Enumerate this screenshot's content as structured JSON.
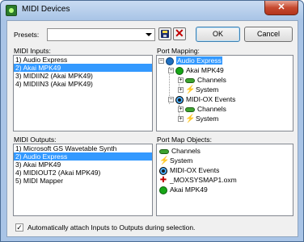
{
  "window": {
    "title": "MIDI Devices",
    "close_label": "✕"
  },
  "presets": {
    "label": "Presets:",
    "value": ""
  },
  "buttons": {
    "ok": "OK",
    "cancel": "Cancel"
  },
  "midi_inputs": {
    "label": "MIDI Inputs:",
    "items": [
      "1) Audio Express",
      "2) Akai MPK49",
      "3) MIDIIN2 (Akai MPK49)",
      "4) MIDIIN3 (Akai MPK49)"
    ],
    "selected_index": 1
  },
  "port_mapping": {
    "label": "Port Mapping:",
    "root": "Audio Express",
    "device1": "Akai MPK49",
    "device1_children": [
      "Channels",
      "System"
    ],
    "device2": "MIDI-OX Events",
    "device2_children": [
      "Channels",
      "System"
    ]
  },
  "midi_outputs": {
    "label": "MIDI Outputs:",
    "items": [
      "1) Microsoft GS Wavetable Synth",
      "2) Audio Express",
      "3) Akai MPK49",
      "4) MIDIOUT2 (Akai MPK49)",
      "5) MIDI Mapper"
    ],
    "selected_index": 1
  },
  "port_map_objects": {
    "label": "Port Map Objects:",
    "items": [
      "Channels",
      "System",
      "MIDI-OX Events",
      "_MOXSYSMAP1.oxm",
      "Akai MPK49"
    ]
  },
  "auto_attach": {
    "label": "Automatically attach Inputs to Outputs during selection.",
    "checked": true,
    "mark": "✓"
  },
  "icons": {
    "app": "midi-app-icon",
    "save": "save-icon",
    "delete": "delete-icon",
    "dropdown": "chevron-down-icon"
  }
}
